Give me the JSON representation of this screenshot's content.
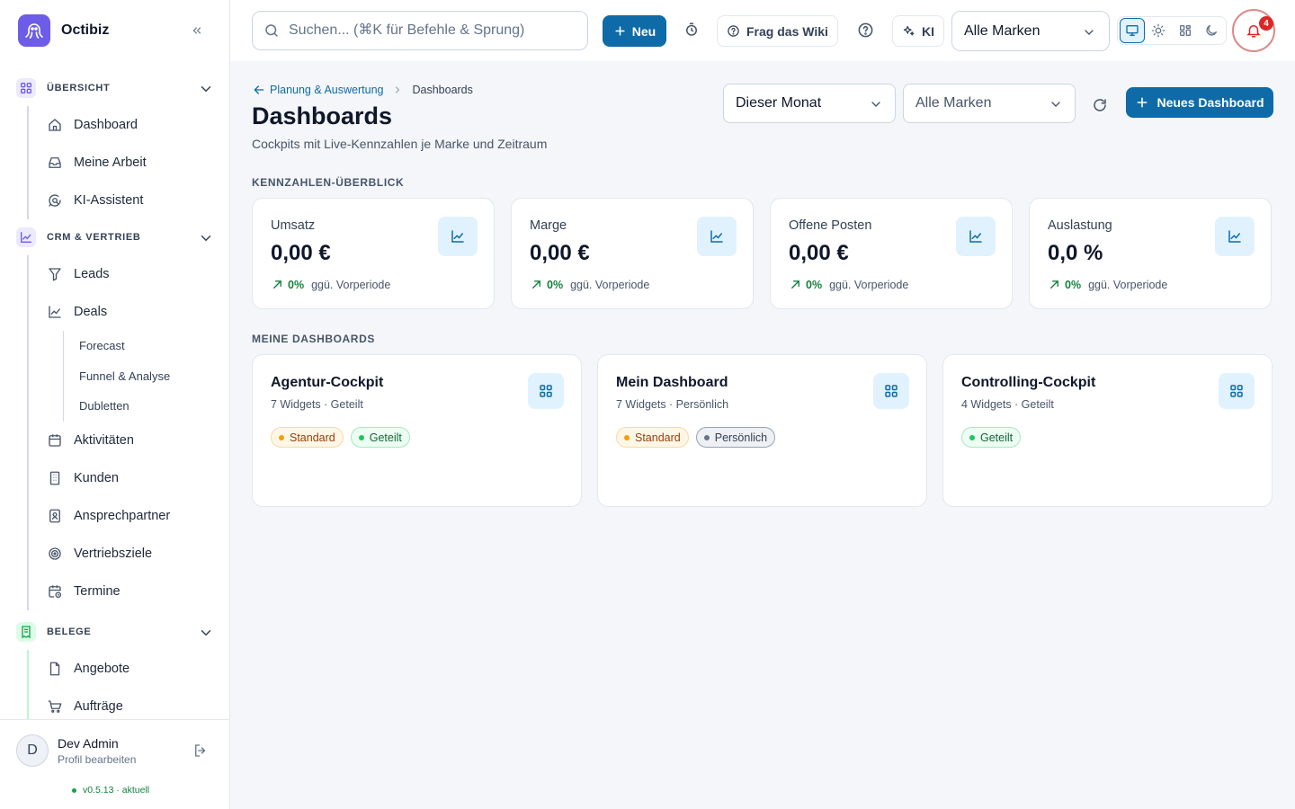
{
  "app": {
    "name": "Octibiz"
  },
  "sidebar": {
    "sections": [
      {
        "label": "ÜBERSICHT",
        "items": [
          "Dashboard",
          "Meine Arbeit",
          "KI-Assistent"
        ]
      },
      {
        "label": "CRM & VERTRIEB",
        "items": [
          "Leads",
          "Deals",
          "Aktivitäten",
          "Kunden",
          "Ansprechpartner",
          "Vertriebsziele",
          "Termine"
        ],
        "deals_sub": [
          "Forecast",
          "Funnel & Analyse",
          "Dubletten"
        ]
      },
      {
        "label": "BELEGE",
        "items": [
          "Angebote",
          "Aufträge"
        ]
      }
    ],
    "user": {
      "initial": "D",
      "name": "Dev Admin",
      "edit": "Profil bearbeiten",
      "version": "v0.5.13",
      "version_state": "· aktuell"
    },
    "colors": {
      "overview": "#6d5ce8",
      "crm": "#6d5ce8",
      "belege": "#16a34a"
    }
  },
  "topbar": {
    "search_placeholder": "Suchen... (⌘K für Befehle & Sprung)",
    "new_label": "Neu",
    "wiki_label": "Frag das Wiki",
    "ai_label": "KI",
    "brand_select": "Alle Marken",
    "notifications": "4"
  },
  "page": {
    "breadcrumb_parent": "Planung & Auswertung",
    "breadcrumb_current": "Dashboards",
    "title": "Dashboards",
    "subtitle": "Cockpits mit Live-Kennzahlen je Marke und Zeitraum",
    "period_select": "Dieser Monat",
    "brand_select": "Alle Marken",
    "new_dashboard": "Neues Dashboard",
    "kpi_heading": "KENNZAHLEN-ÜBERBLICK",
    "dash_heading": "MEINE DASHBOARDS"
  },
  "kpis": [
    {
      "label": "Umsatz",
      "value": "0,00 €",
      "delta": "0%",
      "compare": "ggü. Vorperiode"
    },
    {
      "label": "Marge",
      "value": "0,00 €",
      "delta": "0%",
      "compare": "ggü. Vorperiode"
    },
    {
      "label": "Offene Posten",
      "value": "0,00 €",
      "delta": "0%",
      "compare": "ggü. Vorperiode"
    },
    {
      "label": "Auslastung",
      "value": "0,0 %",
      "delta": "0%",
      "compare": "ggü. Vorperiode"
    }
  ],
  "dashboards": [
    {
      "name": "Agentur-Cockpit",
      "meta": "7 Widgets · Geteilt",
      "tags": [
        "Standard",
        "Geteilt"
      ]
    },
    {
      "name": "Mein Dashboard",
      "meta": "7 Widgets · Persönlich",
      "tags": [
        "Standard",
        "Persönlich"
      ]
    },
    {
      "name": "Controlling-Cockpit",
      "meta": "4 Widgets · Geteilt",
      "tags": [
        "Geteilt"
      ]
    }
  ],
  "colors": {
    "primary": "#0e6ba8",
    "positive": "#15803d",
    "danger": "#dc2626"
  }
}
